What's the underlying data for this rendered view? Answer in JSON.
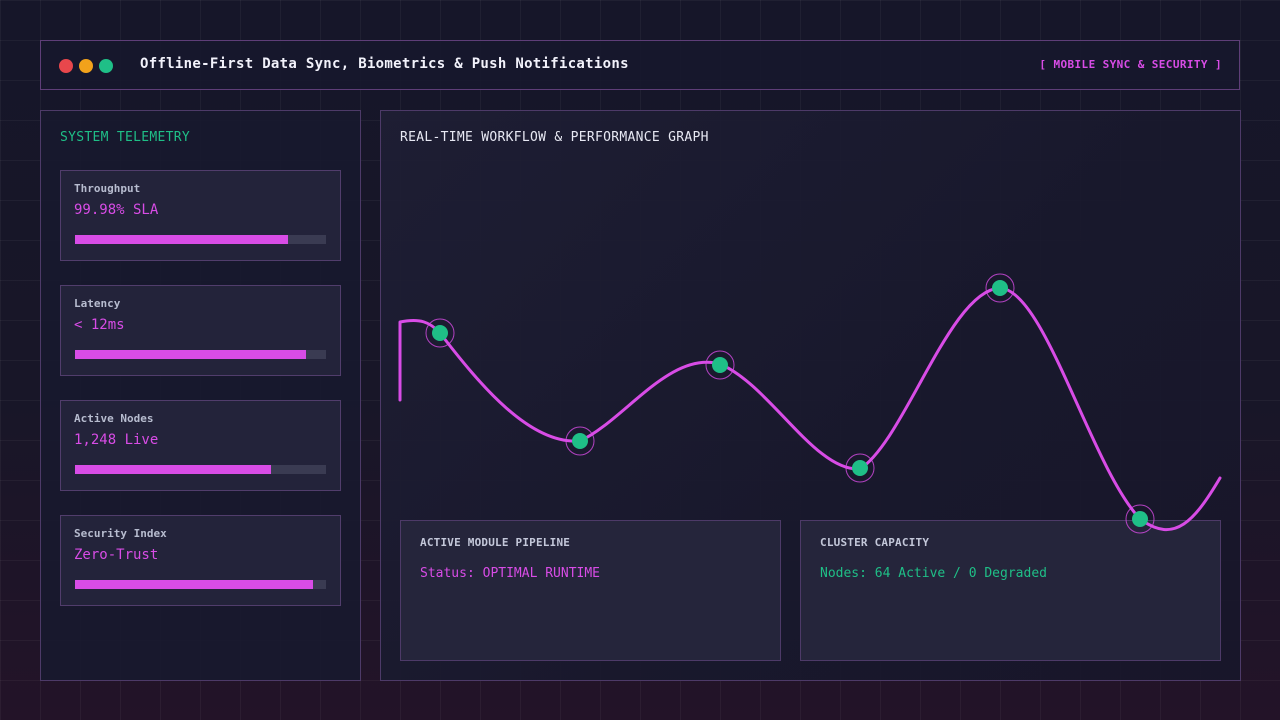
{
  "window": {
    "title": "Offline-First Data Sync, Biometrics & Push Notifications",
    "tag": "[ MOBILE SYNC & SECURITY ]",
    "controls": [
      "close",
      "minimize",
      "maximize"
    ]
  },
  "colors": {
    "accent_magenta": "#d84ce6",
    "accent_green": "#1fbf87",
    "dot_red": "#e8474c",
    "dot_amber": "#f2a21b",
    "dot_green": "#1fbf87"
  },
  "telemetry": {
    "title": "SYSTEM TELEMETRY",
    "metrics": [
      {
        "label": "Throughput",
        "value": "99.98% SLA",
        "level": 0.85
      },
      {
        "label": "Latency",
        "value": "< 12ms",
        "level": 0.92
      },
      {
        "label": "Active Nodes",
        "value": "1,248 Live",
        "level": 0.78
      },
      {
        "label": "Security Index",
        "value": "Zero-Trust",
        "level": 0.95
      }
    ]
  },
  "graph": {
    "title": "REAL-TIME WORKFLOW & PERFORMANCE GRAPH"
  },
  "pipeline": {
    "title": "ACTIVE MODULE PIPELINE",
    "status": "Status: OPTIMAL RUNTIME"
  },
  "capacity": {
    "title": "CLUSTER CAPACITY",
    "status": "Nodes: 64 Active / 0 Degraded"
  }
}
